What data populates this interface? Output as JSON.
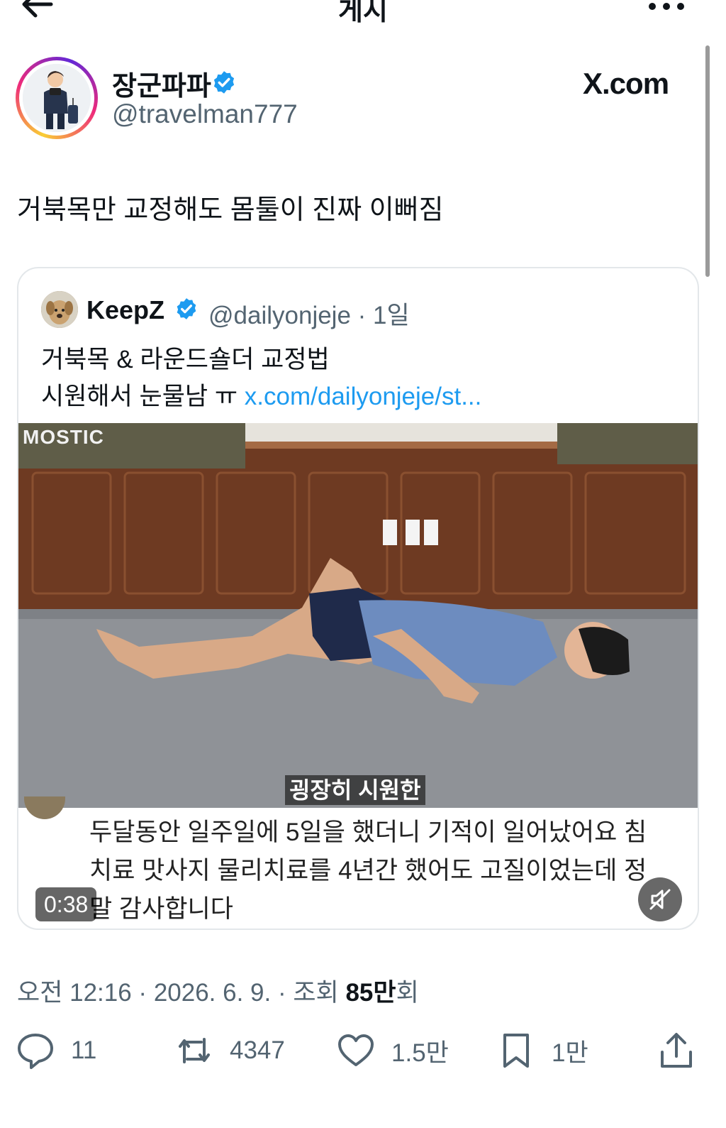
{
  "header": {
    "title": "게시",
    "back_icon": "arrow-left-icon",
    "more_icon": "more-horizontal-icon"
  },
  "post": {
    "author": {
      "display_name": "장군파파",
      "handle": "@travelman777",
      "verified": true
    },
    "brand_watermark": "X.com",
    "text": "거북목만 교정해도 몸툴이 진짜 이뻐짐"
  },
  "quote": {
    "author": {
      "display_name": "KeepZ",
      "handle": "@dailyonjeje · 1일",
      "verified": true
    },
    "text_line1": "거북목 & 라운드숄더 교정법",
    "text_line2": "시원해서 눈물남 ㅠ",
    "link": "x.com/dailyonjeje/st..."
  },
  "video": {
    "watermark": "MOSTIC",
    "subtitle": "굉장히 시원한",
    "comment_lines": [
      "두달동안 일주일에 5일을 했더니 기적이 일어났어요 침",
      "치료 맛사지 물리치료를 4년간 했어도 고질이었는데 정",
      "말 감사합니다"
    ],
    "duration": "0:38",
    "mute_icon": "volume-muted-icon"
  },
  "meta": {
    "time_date": "오전 12:16 · 2026. 6. 9. · 조회 ",
    "views_value": "85만",
    "views_suffix": "회"
  },
  "actions": {
    "replies": "11",
    "reposts": "4347",
    "likes": "1.5만",
    "bookmarks": "1만"
  },
  "colors": {
    "accent": "#1d9bf0",
    "text_primary": "#0f1419",
    "text_secondary": "#536471"
  }
}
